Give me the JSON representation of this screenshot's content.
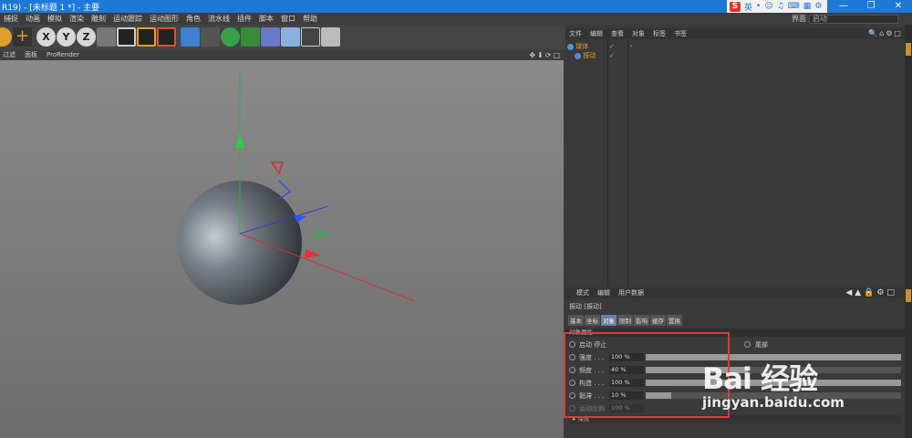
{
  "titlebar": {
    "title": "R19) - [未标题 1 *] - 主要",
    "controls": [
      "—",
      "❐",
      "✕"
    ]
  },
  "ime": {
    "logo": "S",
    "label": "英",
    "icons": [
      "•",
      "☺",
      "♫",
      "⌨",
      "▦",
      "⚙"
    ]
  },
  "menu": {
    "items": [
      "捕捉",
      "动画",
      "模拟",
      "渲染",
      "雕刻",
      "运动跟踪",
      "运动图形",
      "角色",
      "流水线",
      "插件",
      "脚本",
      "窗口",
      "帮助"
    ]
  },
  "layout": {
    "label": "界面",
    "value": "启动"
  },
  "toolbar": {
    "axis_x": "X",
    "axis_y": "Y",
    "axis_z": "Z"
  },
  "viewport_tabs": {
    "items": [
      "过滤",
      "面板",
      "ProRender"
    ],
    "icons": "✥⬇⟳□"
  },
  "object_manager": {
    "tabs": [
      "文件",
      "编辑",
      "查看",
      "对象",
      "标签",
      "书签"
    ],
    "icons": "🔍⌂⚙□",
    "rows": [
      {
        "name": "球体"
      },
      {
        "name": "振动"
      }
    ]
  },
  "attr_manager": {
    "tabs": [
      "模式",
      "编辑",
      "用户数据"
    ],
    "icons": "◀▲🔒⚙□",
    "title": "振动 [振动]",
    "subtabs": [
      "基本",
      "坐标",
      "对象",
      "限制",
      "影响",
      "缓存",
      "置换"
    ],
    "section": "对象属性",
    "start_stop": "启动 停止",
    "rows": [
      {
        "label": "强度 . . .",
        "value": "100 %",
        "fill": 1.0
      },
      {
        "label": "频度 . . .",
        "value": "40 %",
        "fill": 0.4
      },
      {
        "label": "构造 . . .",
        "value": "100 %",
        "fill": 1.0
      },
      {
        "label": "黏滞 . . .",
        "value": "10 %",
        "fill": 0.1
      }
    ],
    "disabled_row": {
      "label": "运动比例",
      "value": "100 %"
    },
    "right_col": {
      "row1": "尾部"
    },
    "footer": "▸ 深度"
  },
  "watermark": {
    "text": "Bai 经验",
    "url": "jingyan.baidu.com"
  },
  "colors": {
    "titlebar": "#1e78d6",
    "accent_orange": "#e0a030",
    "highlight_red": "#e03a3a"
  }
}
